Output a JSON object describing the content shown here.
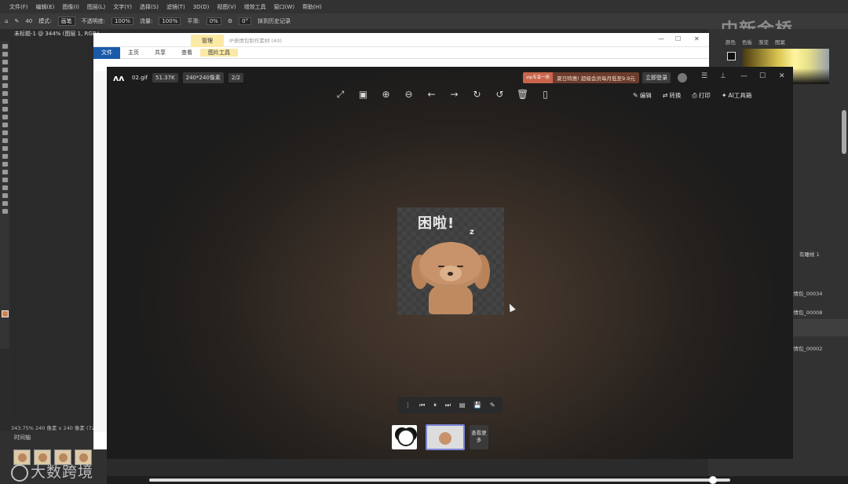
{
  "photoshop": {
    "menu": [
      "文件(F)",
      "编辑(E)",
      "图像(I)",
      "图层(L)",
      "文字(Y)",
      "选择(S)",
      "滤镜(T)",
      "3D(D)",
      "视图(V)",
      "增效工具",
      "窗口(W)",
      "帮助(H)"
    ],
    "options": {
      "brush_size": "40",
      "mode_label": "模式:",
      "mode_value": "画笔",
      "opacity_label": "不透明度:",
      "opacity_value": "100%",
      "flow_label": "流量:",
      "flow_value": "100%",
      "smooth_label": "平滑:",
      "smooth_value": "0%",
      "angle_value": "0°",
      "history_label": "抹到历史记录"
    },
    "doc_tab": "未标题-1 @ 344% (图层 1, RGB/8...",
    "status": "343.75%   240 像素 x 240 像素 (72...",
    "timeline_label": "时间轴",
    "frames": [
      "1",
      "2",
      "3",
      "4"
    ],
    "right_tabs": [
      "颜色",
      "色板",
      "渐变",
      "图案"
    ],
    "layers": [
      "有睡帧 1",
      "表情包_00034",
      "表情包_00008",
      "表情包_00002"
    ],
    "watermark_bottom": "大数跨境",
    "watermark_top": "中新金桥"
  },
  "explorer": {
    "manage_label": "管理",
    "path_hint": "IP表情包制作素材 (40)",
    "ribbon": [
      "文件",
      "主页",
      "共享",
      "查看",
      "图片工具"
    ]
  },
  "viewer": {
    "file_name": "02.gif",
    "file_size": "51.37K",
    "dimensions": "240*240像素",
    "index": "2/2",
    "promo_tag": "vip专享一折",
    "promo_text": "夏日特惠! 超级会员每月低至9.9元",
    "login_label": "立即登录",
    "actions": {
      "edit": "编辑",
      "convert": "转换",
      "print": "打印",
      "ai": "AI工具箱"
    },
    "image_caption": "困啦!",
    "image_z": "z",
    "more_label": "查看更多"
  }
}
